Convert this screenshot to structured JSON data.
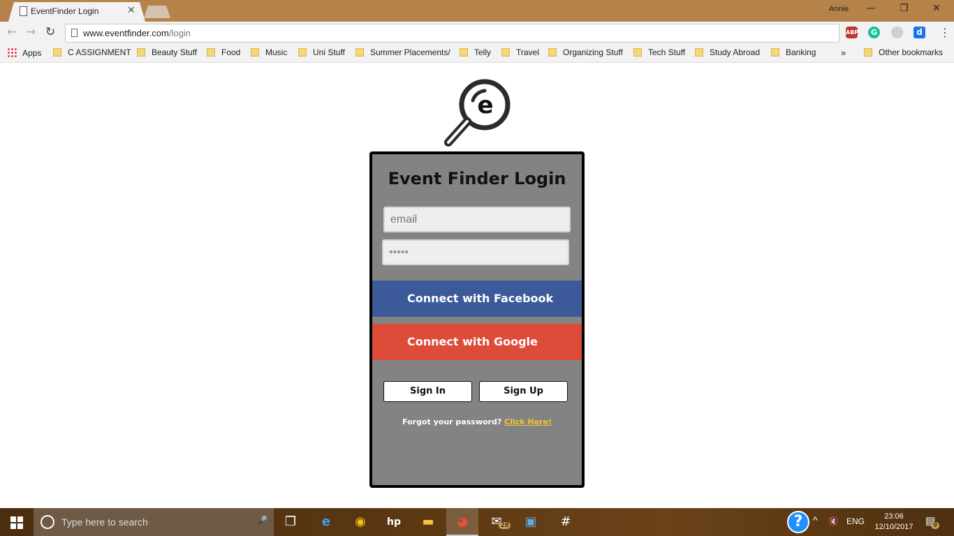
{
  "browser": {
    "tab_title": "EventFinder Login",
    "tab_close": "✕",
    "profile_name": "Annie",
    "url_host": "www.eventfinder.com",
    "url_path": "/login",
    "window_controls": {
      "minimize": "—",
      "restore": "❐",
      "close": "✕"
    },
    "extensions": [
      {
        "name": "adblock-plus",
        "label": "ABP",
        "color": "#c0392b"
      },
      {
        "name": "grammarly",
        "label": "G",
        "color": "#15c39a"
      },
      {
        "name": "shield",
        "label": "",
        "color": "#cfcfcf"
      },
      {
        "name": "d-extension",
        "label": "d",
        "color": "#1a73e8"
      }
    ]
  },
  "bookmarks": {
    "apps": "Apps",
    "items": [
      "C ASSIGNMENT",
      "Beauty Stuff",
      "Food",
      "Music",
      "Uni Stuff",
      "Summer Placements/",
      "Telly",
      "Travel",
      "Organizing Stuff",
      "Tech Stuff",
      "Study Abroad",
      "Banking"
    ],
    "overflow": "»",
    "other": "Other bookmarks"
  },
  "login": {
    "title": "Event Finder Login",
    "email_placeholder": "email",
    "password_value": "•••••",
    "facebook_label": "Connect with Facebook",
    "google_label": "Connect with Google",
    "signin_label": "Sign In",
    "signup_label": "Sign Up",
    "forgot_text": "Forgot your password?",
    "forgot_link": "Click Here!"
  },
  "colors": {
    "card_bg": "#838383",
    "facebook": "#3c5a99",
    "google": "#dd4b39",
    "link": "#f4c430"
  },
  "taskbar": {
    "search_placeholder": "Type here to search",
    "mail_badge": "28",
    "tray_lang": "ENG",
    "time": "23:06",
    "date": "12/10/2017",
    "notification_badge": "9"
  }
}
